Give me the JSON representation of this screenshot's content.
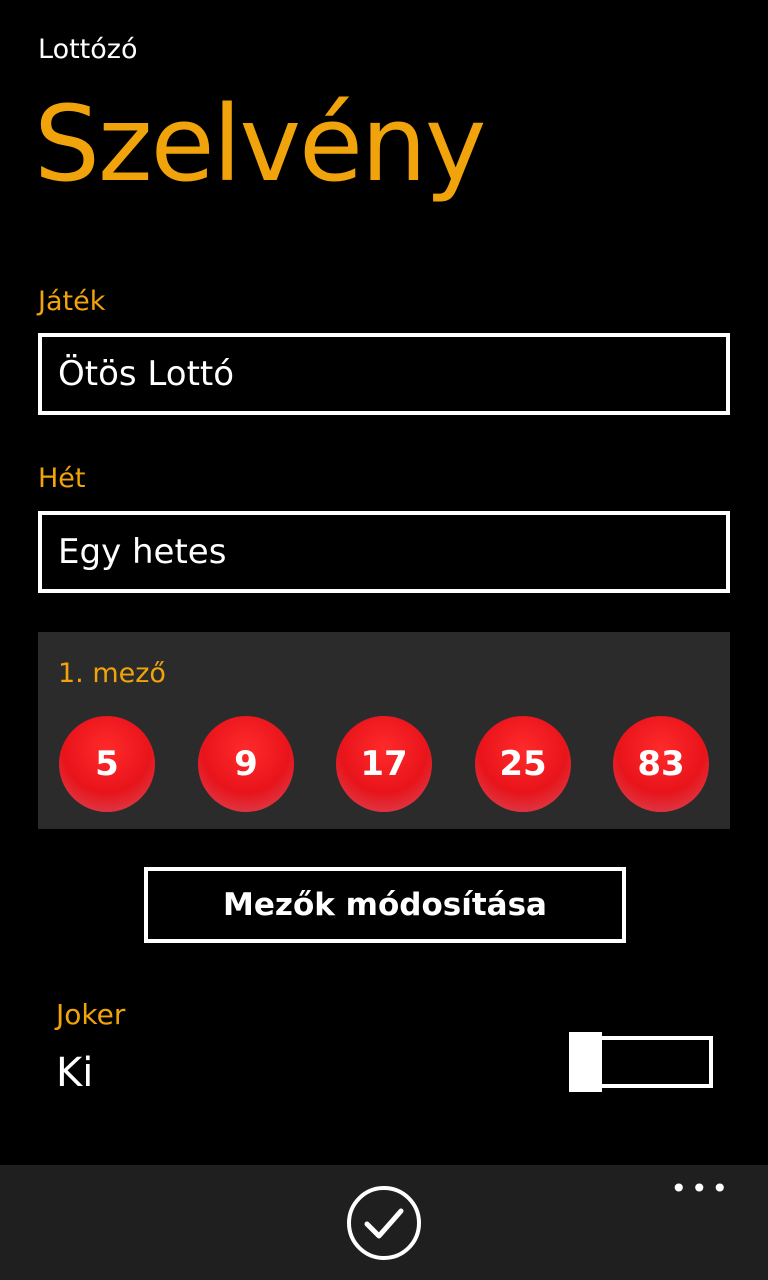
{
  "app": {
    "title": "Lottózó",
    "page_title": "Szelvény"
  },
  "game": {
    "label": "Játék",
    "value": "Ötös Lottó"
  },
  "week": {
    "label": "Hét",
    "value": "Egy hetes"
  },
  "field1": {
    "title": "1. mező",
    "numbers": [
      "5",
      "9",
      "17",
      "25",
      "83"
    ],
    "ball_color": "#e8141b"
  },
  "modify_button": {
    "label": "Mezők módosítása"
  },
  "joker": {
    "label": "Joker",
    "state": "Ki",
    "enabled": false
  },
  "app_bar": {
    "ellipsis": "•••",
    "accept_icon": "check-circle-icon"
  },
  "colors": {
    "accent": "#f0a30a",
    "background": "#000000",
    "panel": "#2b2b2b",
    "app_bar": "#1f1f1f"
  }
}
